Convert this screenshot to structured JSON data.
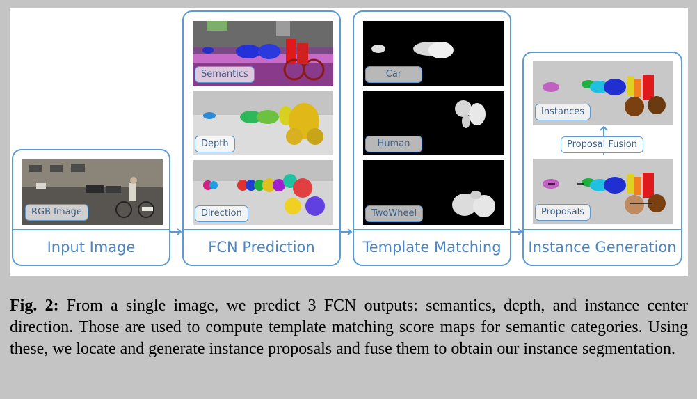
{
  "stages": {
    "input": {
      "title": "Input Image",
      "label": "RGB Image"
    },
    "fcn": {
      "title": "FCN Prediction",
      "labels": [
        "Semantics",
        "Depth",
        "Direction"
      ]
    },
    "template": {
      "title": "Template Matching",
      "labels": [
        "Car",
        "Human",
        "TwoWheel"
      ]
    },
    "instance": {
      "title": "Instance Generation",
      "labels": [
        "Instances",
        "Proposals"
      ],
      "fusion": "Proposal Fusion"
    }
  },
  "caption": {
    "fig_number": "Fig. 2:",
    "text": " From a single image, we predict 3 FCN outputs: semantics, depth, and instance center direction. Those are used to compute template matching score maps for semantic categories. Using these, we locate and generate instance proposals and fuse them to obtain our instance segmentation."
  },
  "colors": {
    "accent": "#5b9bd5",
    "background": "#c4c4c4"
  }
}
